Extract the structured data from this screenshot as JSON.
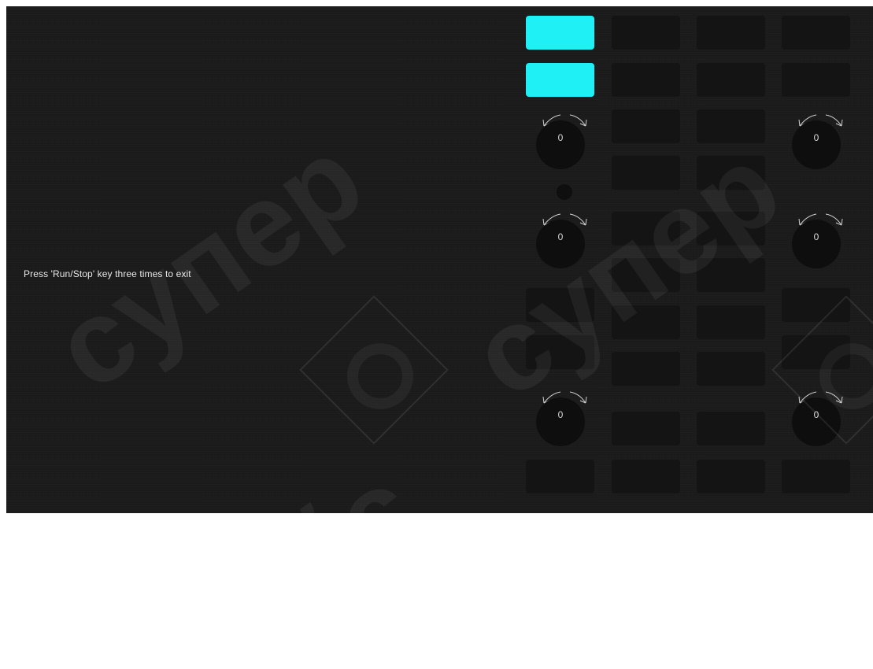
{
  "message": "Press 'Run/Stop' key three times to exit",
  "knob_value": "0",
  "colors": {
    "background": "#1b1b1b",
    "key_idle": "#141414",
    "key_lit": "#1ff0f5",
    "text": "#e8e8e8"
  },
  "keys": [
    {
      "id": "key-c1-r1",
      "lit": true
    },
    {
      "id": "key-c1-r2",
      "lit": true
    },
    {
      "id": "key-c1-r3",
      "lit": false
    },
    {
      "id": "key-c1-r4",
      "lit": false
    },
    {
      "id": "key-c1-r5",
      "lit": false
    },
    {
      "id": "key-c2-r1",
      "lit": false
    },
    {
      "id": "key-c2-r2",
      "lit": false
    },
    {
      "id": "key-c2-r3",
      "lit": false
    },
    {
      "id": "key-c2-r4",
      "lit": false
    },
    {
      "id": "key-c2-r5",
      "lit": false
    },
    {
      "id": "key-c2-r6",
      "lit": false
    },
    {
      "id": "key-c2-r7",
      "lit": false
    },
    {
      "id": "key-c2-r8",
      "lit": false
    },
    {
      "id": "key-c2-r9",
      "lit": false
    },
    {
      "id": "key-c2-r10",
      "lit": false
    },
    {
      "id": "key-c3-r1",
      "lit": false
    },
    {
      "id": "key-c3-r2",
      "lit": false
    },
    {
      "id": "key-c3-r3",
      "lit": false
    },
    {
      "id": "key-c3-r4",
      "lit": false
    },
    {
      "id": "key-c3-r5",
      "lit": false
    },
    {
      "id": "key-c3-r6",
      "lit": false
    },
    {
      "id": "key-c3-r7",
      "lit": false
    },
    {
      "id": "key-c3-r8",
      "lit": false
    },
    {
      "id": "key-c3-r9",
      "lit": false
    },
    {
      "id": "key-c3-r10",
      "lit": false
    },
    {
      "id": "key-c4-r1",
      "lit": false
    },
    {
      "id": "key-c4-r2",
      "lit": false
    },
    {
      "id": "key-c4-r3",
      "lit": false
    },
    {
      "id": "key-c4-r4",
      "lit": false
    },
    {
      "id": "key-c4-r5",
      "lit": false
    }
  ],
  "knobs": [
    {
      "id": "knob-1",
      "value": "0"
    },
    {
      "id": "knob-2",
      "value": "0"
    },
    {
      "id": "knob-3",
      "value": "0"
    },
    {
      "id": "knob-4",
      "value": "0"
    },
    {
      "id": "knob-5",
      "value": "0"
    },
    {
      "id": "knob-6",
      "value": "0"
    }
  ],
  "watermark": {
    "text": "супер",
    "text2": "айс"
  }
}
